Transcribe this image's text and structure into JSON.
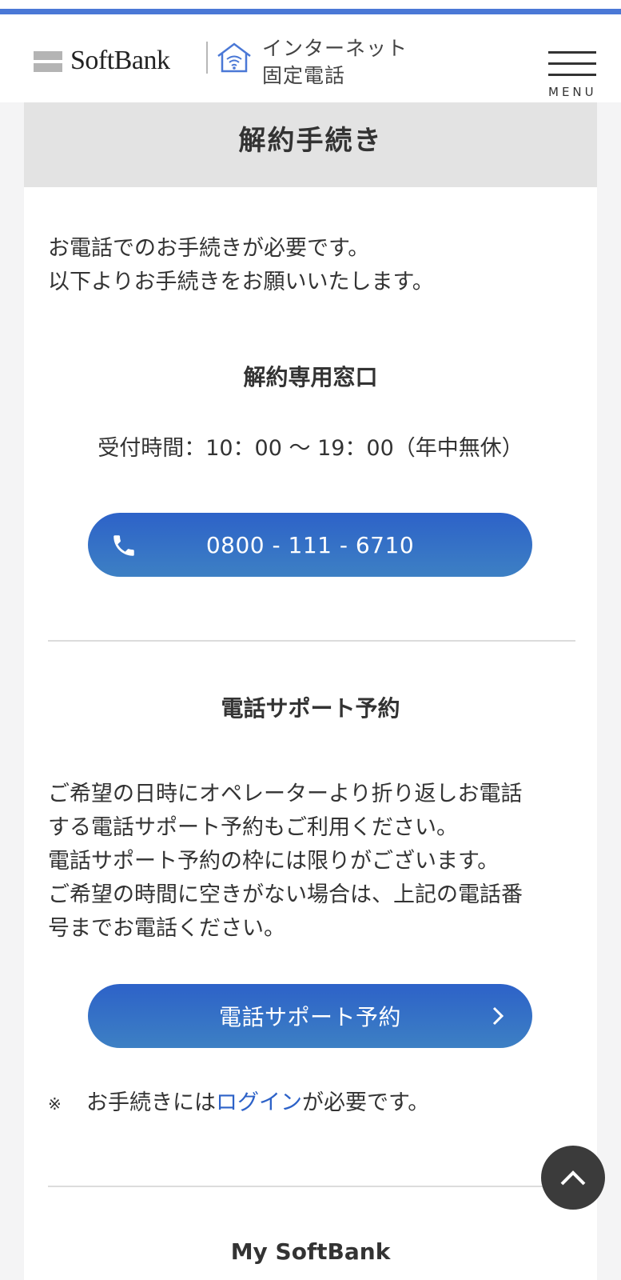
{
  "header": {
    "logo_text": "SoftBank",
    "service_line1": "インターネット",
    "service_line2": "固定電話",
    "menu_label": "MENU"
  },
  "page": {
    "title": "解約手続き",
    "intro_line1": "お電話でのお手続きが必要です。",
    "intro_line2": "以下よりお手続きをお願いいたします。"
  },
  "cancellation_desk": {
    "heading": "解約専用窓口",
    "hours": "受付時間：10：00 〜 19：00（年中無休）",
    "phone_number": "0800 - 111 - 6710"
  },
  "phone_support": {
    "heading": "電話サポート予約",
    "text_lines": [
      "ご希望の日時にオペレーターより折り返しお電話",
      "する電話サポート予約もご利用ください。",
      "電話サポート予約の枠には限りがございます。",
      "ご希望の時間に空きがない場合は、上記の電話番",
      "号までお電話ください。"
    ],
    "button_label": "電話サポート予約",
    "note_mark": "※",
    "note_prefix": "お手続きには",
    "note_link": "ログイン",
    "note_suffix": "が必要です。"
  },
  "footer_section": {
    "heading": "My SoftBank"
  },
  "colors": {
    "accent": "#4a78d6",
    "button_blue": "#2d62c8",
    "link_blue": "#2d62c8"
  }
}
